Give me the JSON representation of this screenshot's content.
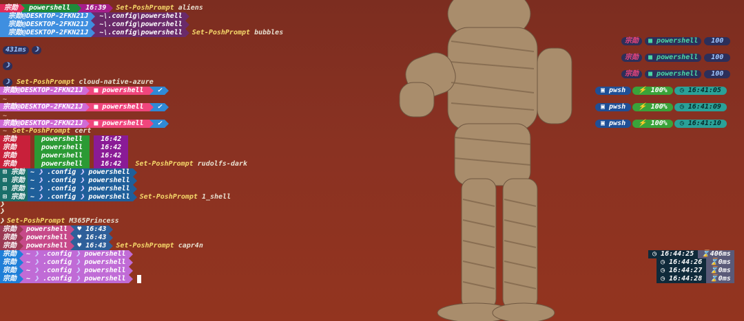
{
  "user": "宗勋",
  "host_user": "宗勋@DESKTOP-2FKN21J",
  "folder": "powershell",
  "path": "~\\.config\\powershell",
  "path_parts": [
    "~",
    ".config",
    "powershell"
  ],
  "aliens": {
    "time": "16:39",
    "cmd": "Set-PoshPrompt",
    "arg": "aliens"
  },
  "bubbles_cmd": {
    "cmd": "Set-PoshPrompt",
    "arg": "bubbles"
  },
  "duration": "431ms",
  "moon": "☽",
  "cloud_native_cmd": {
    "cmd": "Set-PoshPrompt",
    "arg": "cloud-native-azure"
  },
  "tilde": "~",
  "cert_cmd": {
    "cmd": "Set-PoshPrompt",
    "arg": "cert"
  },
  "cert_times": [
    "16:42",
    "16:42",
    "16:42",
    "16:42"
  ],
  "rudolfs_cmd": {
    "cmd": "Set-PoshPrompt",
    "arg": "rudolfs-dark"
  },
  "shell_cmd": {
    "cmd": "Set-PoshPrompt",
    "arg": "1_shell"
  },
  "chevron": "❯",
  "m365_cmd": {
    "cmd": "Set-PoshPrompt",
    "arg": "M365Princess"
  },
  "princess_times": [
    "16:43",
    "16:43",
    "16:43"
  ],
  "heart": "♥",
  "capr4n_cmd": {
    "cmd": "Set-PoshPrompt",
    "arg": "capr4n"
  },
  "right_bubbles": {
    "user": "宗勋",
    "folder": "powershell",
    "battery": "100"
  },
  "right_cloud": {
    "shell": "pwsh",
    "battery": "100%",
    "times": [
      "16:41:05",
      "16:41:09",
      "16:41:10"
    ]
  },
  "right_capr4n": [
    {
      "time": "16:44:25",
      "dur": "406ms"
    },
    {
      "time": "16:44:26",
      "dur": "0ms"
    },
    {
      "time": "16:44:27",
      "dur": "0ms"
    },
    {
      "time": "16:44:28",
      "dur": "0ms"
    }
  ],
  "colors": {
    "aliens_user": "#e02b5a",
    "aliens_folder": "#1f8a3a",
    "aliens_time": "#a61e8a",
    "bubbles_host": "#3f8fe0",
    "bubbles_path": "#6a2a6a",
    "cloud_host": "#d06bd6",
    "cloud_folder": "#f0467d",
    "cloud_git": "#2f8ad6",
    "cert_user": "#c8203a",
    "cert_folder": "#2b9a34",
    "cert_time": "#8a1b96",
    "rudolfs_user": "#1a6f6a",
    "rudolfs_path": "#1f5f9a",
    "princess_user": "#9b3a54",
    "princess_folder": "#c74a8a",
    "princess_time": "#2e5f9a",
    "capr4n_user": "#1f7fd8",
    "capr4n_path": "#c06bd6"
  }
}
